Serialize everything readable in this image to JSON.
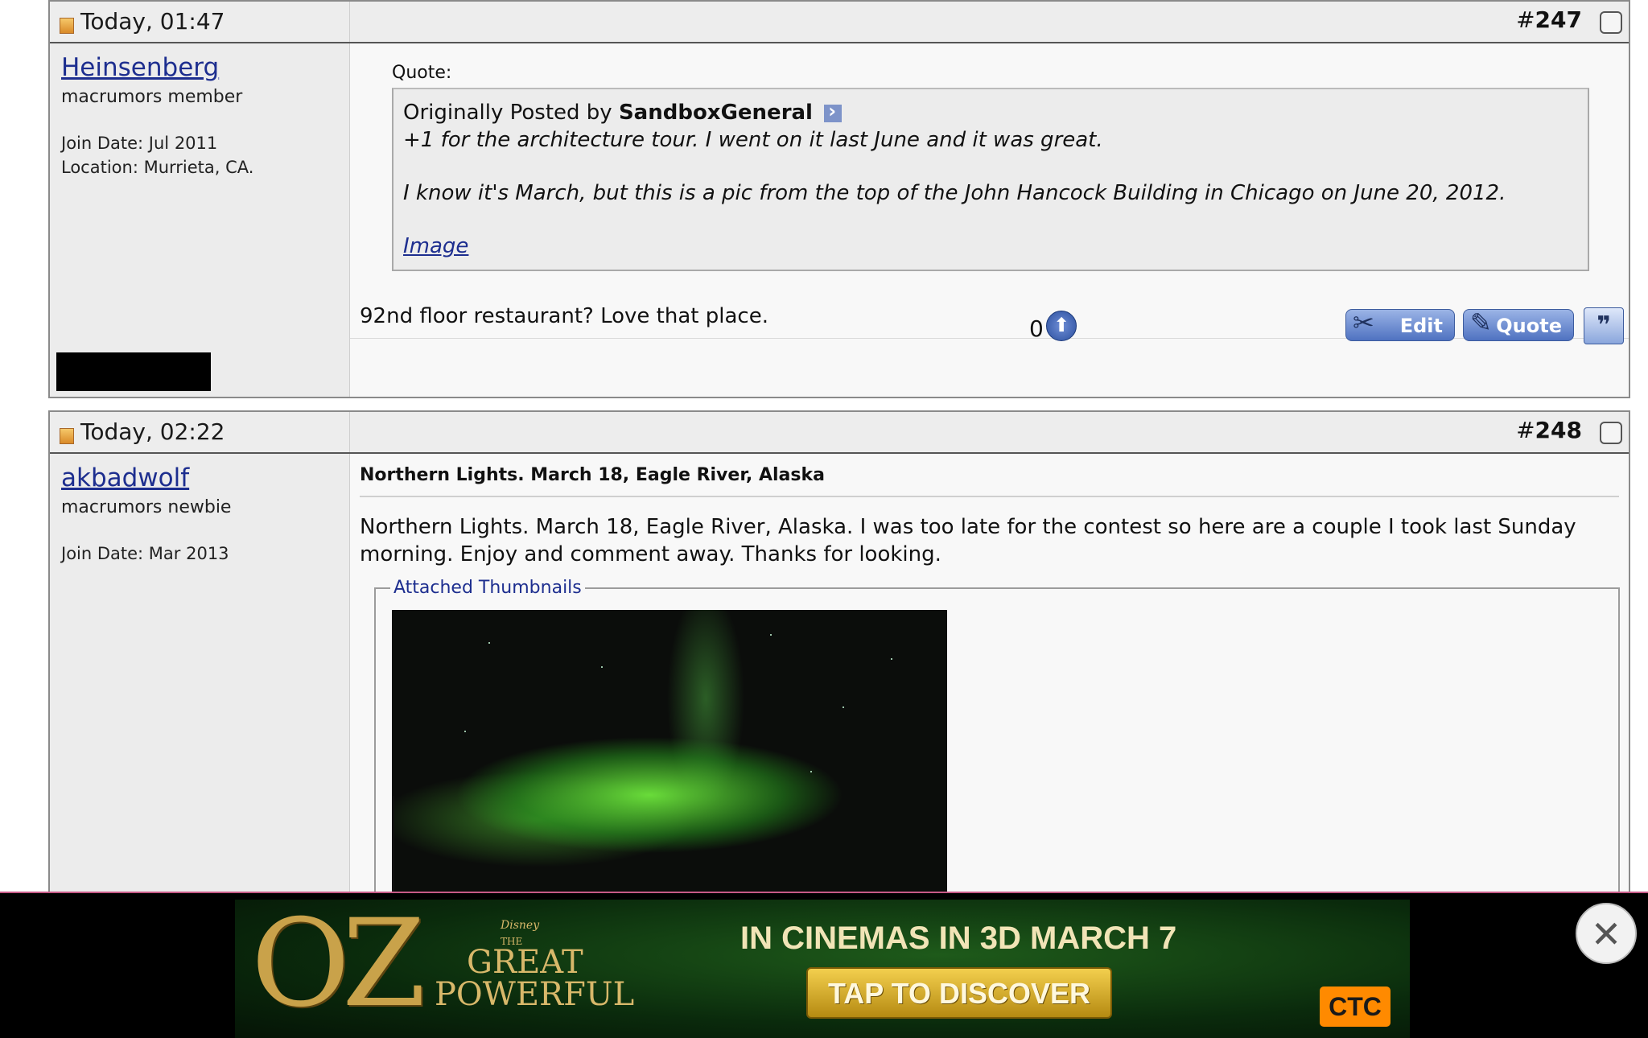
{
  "posts": [
    {
      "date": "Today, 01:47",
      "number_prefix": "#",
      "number": "247",
      "user": {
        "name": "Heinsenberg",
        "title": "macrumors member",
        "join_date": "Join Date: Jul 2011",
        "location": "Location: Murrieta, CA."
      },
      "quote": {
        "label": "Quote:",
        "originally_posted_by": "Originally Posted by",
        "author": "SandboxGeneral",
        "line1": "+1 for the architecture tour. I went on it last June and it was great.",
        "line2": "I know it's March, but this is a pic from the top of the John Hancock Building in Chicago on June 20, 2012.",
        "link": "Image"
      },
      "message": "92nd floor restaurant? Love that place.",
      "footer": {
        "vote_count": "0",
        "edit_label": "Edit",
        "quote_label": "Quote"
      }
    },
    {
      "date": "Today, 02:22",
      "number_prefix": "#",
      "number": "248",
      "user": {
        "name": "akbadwolf",
        "title": "macrumors newbie",
        "join_date": "Join Date: Mar 2013"
      },
      "title": "Northern Lights. March 18, Eagle River, Alaska",
      "message": "Northern Lights. March 18, Eagle River, Alaska. I was too late for the contest so here are a couple I took last Sunday morning. Enjoy and comment away. Thanks for looking.",
      "attachments_label": "Attached Thumbnails"
    }
  ],
  "ad": {
    "logo": "OZ",
    "disney": "Disney",
    "title_top": "THE",
    "title_line1": "GREAT",
    "title_line2": "POWERFUL",
    "headline": "IN CINEMAS IN 3D MARCH 7",
    "cta": "TAP TO DISCOVER",
    "badge": "CTC",
    "close_glyph": "✕"
  },
  "icons": [
    "post-status-icon",
    "checkbox-icon",
    "view-post-arrow-icon",
    "vote-up-icon",
    "scissors-icon",
    "pencil-icon",
    "multiquote-icon",
    "close-icon"
  ]
}
